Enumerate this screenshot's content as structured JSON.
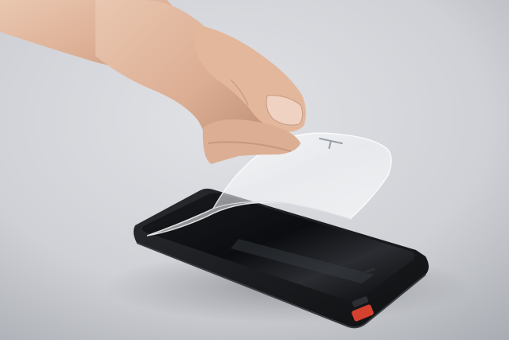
{
  "scene": {
    "subject": "hand-peeling-screen-protector",
    "objects": [
      "hand",
      "screen-protector-film",
      "smartphone",
      "phone-case",
      "red-button"
    ],
    "colors": {
      "background_light": "#dcdde1",
      "background_dark": "#a9acb2",
      "skin": "#e2b9a0",
      "skin_shadow": "#b98a70",
      "phone_body": "#1b1c1f",
      "phone_screen": "#0c0d10",
      "film": "#ffffff",
      "accent_red": "#d5412f"
    }
  }
}
